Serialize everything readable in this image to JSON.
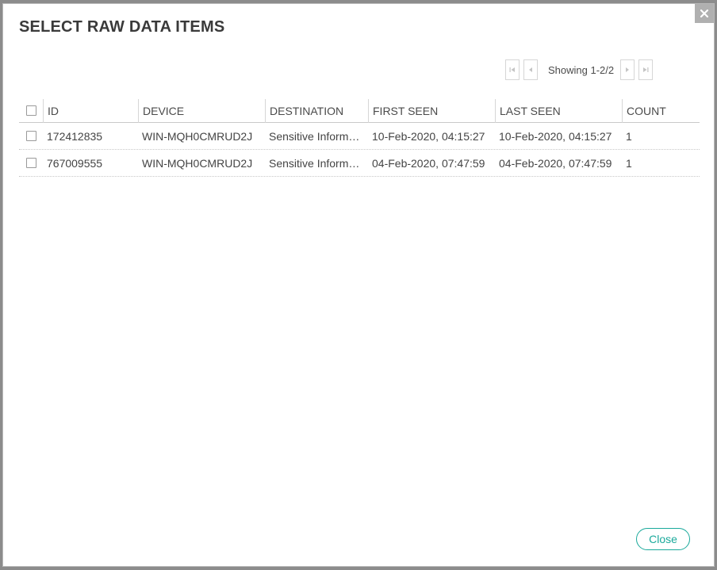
{
  "dialog": {
    "title": "SELECT RAW DATA ITEMS",
    "close_icon": "close-icon",
    "close_label": "Close"
  },
  "pager": {
    "text": "Showing 1-2/2",
    "icons": [
      "first-page-icon",
      "prev-page-icon",
      "next-page-icon",
      "last-page-icon"
    ]
  },
  "table": {
    "headers": [
      "ID",
      "DEVICE",
      "DESTINATION",
      "FIRST SEEN",
      "LAST SEEN",
      "COUNT"
    ],
    "rows": [
      {
        "id": "172412835",
        "device": "WIN-MQH0CMRUD2J",
        "destination": "Sensitive Inform…",
        "first_seen": "10-Feb-2020, 04:15:27",
        "last_seen": "10-Feb-2020, 04:15:27",
        "count": "1"
      },
      {
        "id": "767009555",
        "device": "WIN-MQH0CMRUD2J",
        "destination": "Sensitive Inform…",
        "first_seen": "04-Feb-2020, 07:47:59",
        "last_seen": "04-Feb-2020, 07:47:59",
        "count": "1"
      }
    ]
  },
  "colors": {
    "accent": "#1aa99b",
    "title": "#3a3a3a",
    "close_x_bg": "#b0b0b0"
  }
}
